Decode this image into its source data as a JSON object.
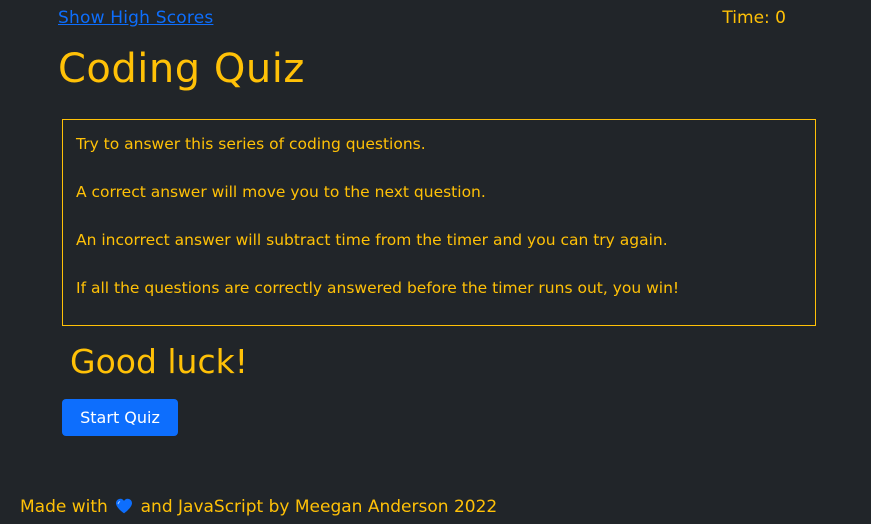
{
  "header": {
    "high_scores_link": "Show High Scores",
    "timer_label": "Time:",
    "timer_value": "0"
  },
  "main": {
    "title": "Coding Quiz",
    "rules": [
      "Try to answer this series of coding questions.",
      "A correct answer will move you to the next question.",
      "An incorrect answer will subtract time from the timer and you can try again.",
      "If all the questions are correctly answered before the timer runs out, you win!"
    ],
    "good_luck": "Good luck!",
    "start_button": "Start Quiz"
  },
  "footer": {
    "prefix": "Made with",
    "heart_icon": "heart-icon",
    "suffix": "and JavaScript by Meegan Anderson 2022"
  },
  "colors": {
    "background": "#212529",
    "accent": "#ffc107",
    "link": "#0d6efd",
    "button": "#0d6efd",
    "heart": "#0d6efd"
  }
}
